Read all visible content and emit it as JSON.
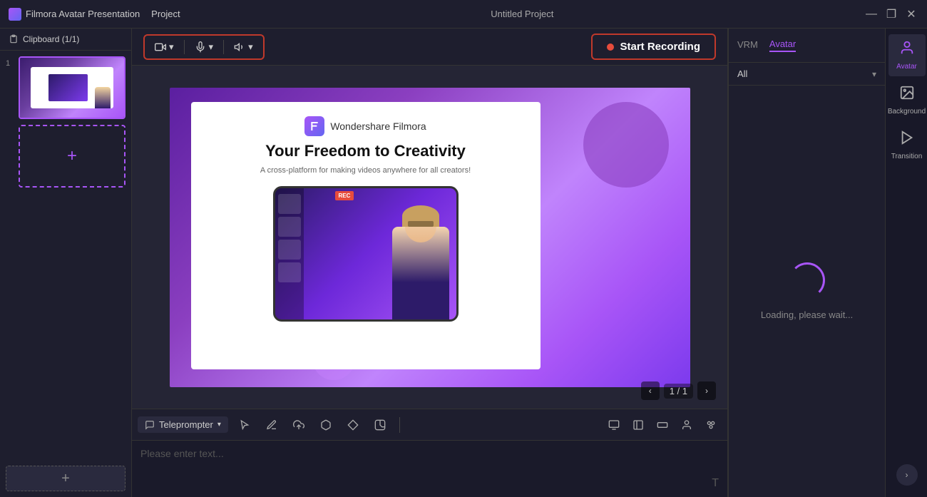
{
  "titlebar": {
    "app_name": "Filmora Avatar Presentation",
    "menu_items": [
      "Project"
    ],
    "window_title": "Untitled Project",
    "minimize": "—",
    "maximize": "❐",
    "close": "✕"
  },
  "left_panel": {
    "clipboard_label": "Clipboard (1/1)",
    "slide_number": "1",
    "add_slide_label": "+"
  },
  "toolbar": {
    "camera_label": "Camera",
    "mic_label": "Mic",
    "speaker_label": "Speaker",
    "record_button": "Start Recording"
  },
  "canvas": {
    "filmora_brand": "Wondershare Filmora",
    "slide_title": "Your Freedom to Creativity",
    "slide_subtitle": "A cross-platform for making videos anywhere for all creators!",
    "page_info": "1 / 1"
  },
  "bottom_toolbar": {
    "teleprompter_label": "Teleprompter",
    "placeholder_text": "Please enter text..."
  },
  "right_panel": {
    "tab_vrm": "VRM",
    "tab_avatar": "Avatar",
    "dropdown_label": "All",
    "loading_text": "Loading, please wait...",
    "icon_avatar_label": "Avatar",
    "icon_background_label": "Background",
    "icon_transition_label": "Transition"
  }
}
